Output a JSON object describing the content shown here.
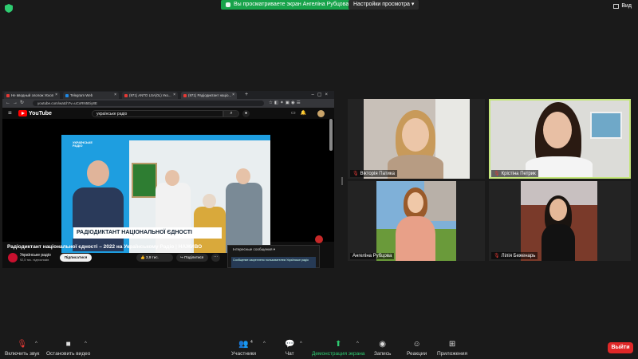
{
  "top_bar": {
    "share_banner": "Вы просматриваете экран Ангеліна Рубцова",
    "view_options": "Настройки просмотра",
    "view_toggle": "Вид"
  },
  "browser": {
    "tabs": [
      {
        "label": "Не вводный злолож Ускоп",
        "favicon": "red"
      },
      {
        "label": "Telegram Web",
        "favicon": "blue"
      },
      {
        "label": "(971) ANTO LSA(0L) Уко...",
        "favicon": "red"
      },
      {
        "label": "(971) Радіодиктант націо...",
        "favicon": "red",
        "active": true
      }
    ],
    "new_tab": "+",
    "url": "youtube.com/watch?v=uCxRN5Eiy8E"
  },
  "youtube": {
    "logo_text": "YouTube",
    "search_query": "українське радіо",
    "video_lower_third": "РАДІОДИКТАНТ НАЦІОНАЛЬНОЇ ЄДНОСТІ",
    "show_logo": "УКРАЇНСЬКЕ РАДІО",
    "video_title": "Радіодиктант національної єдності – 2022 на Українському Радіо | НАЖИВО",
    "channel_name": "Українське радіо",
    "channel_subs": "92,5 тис. підписників",
    "subscribe": "Підписатися",
    "likes": "3,9 тис.",
    "share": "Поділитися",
    "more": "···",
    "chat_header": "Інтересные сообщения",
    "chat_banner": "Сообщение закреплено пользователем Українське радіо"
  },
  "participants": [
    {
      "name": "Вікторія Патика",
      "muted": true,
      "active": false
    },
    {
      "name": "Крістіна Петрик",
      "muted": true,
      "active": true
    },
    {
      "name": "Ангеліна Рубцова",
      "muted": false,
      "active": false
    },
    {
      "name": "Лілія Беженарь",
      "muted": true,
      "active": false
    }
  ],
  "toolbar": {
    "mute": "Включить звук",
    "video": "Остановить видео",
    "participants": "Участники",
    "participants_count": "4",
    "chat": "Чат",
    "share_screen": "Демонстрация экрана",
    "record": "Запись",
    "reactions": "Реакции",
    "apps": "Приложения",
    "leave": "Выйти"
  },
  "colors": {
    "share_green": "#17a34a",
    "active_speaker": "#c4e67a",
    "leave_red": "#e02828"
  }
}
